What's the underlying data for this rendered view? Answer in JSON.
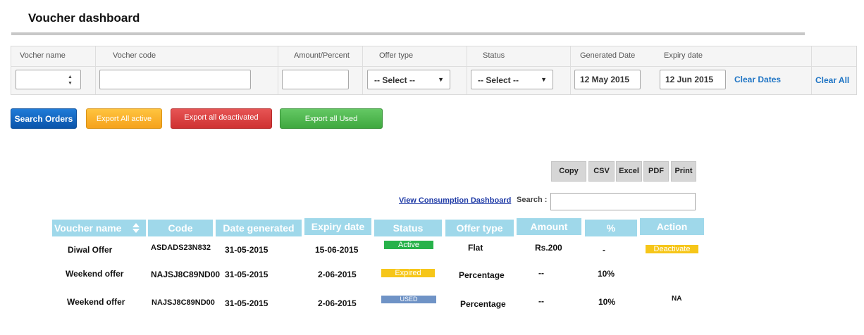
{
  "page": {
    "title": "Voucher dashboard"
  },
  "filter": {
    "headers": {
      "voucher_name": "Vocher name",
      "voucher_code": "Vocher code",
      "amount_percent": "Amount/Percent",
      "offer_type": "Offer type",
      "status": "Status",
      "generated_date": "Generated Date",
      "expiry_date": "Expiry date"
    },
    "offer_type_selected": "-- Select --",
    "status_selected": "-- Select --",
    "generated_date_value": "12 May 2015",
    "expiry_date_value": "12 Jun 2015",
    "clear_dates": "Clear Dates",
    "clear_all": "Clear All"
  },
  "actions": {
    "search_orders": "Search Orders",
    "export_active": "Export All active",
    "export_deactivated": "Export all deactivated",
    "export_used": "Export all Used"
  },
  "toolbar": {
    "copy": "Copy",
    "csv": "CSV",
    "excel": "Excel",
    "pdf": "PDF",
    "print": "Print"
  },
  "table_controls": {
    "view_consumption": "View Consumption Dashboard",
    "search_label": "Search :"
  },
  "table": {
    "columns": [
      "Voucher name",
      "Code",
      "Date generated",
      "Expiry date",
      "Status",
      "Offer type",
      "Amount",
      "%",
      "Action"
    ],
    "rows": [
      {
        "name": "Diwal Offer",
        "code": "ASDADS23N832",
        "date_generated": "31-05-2015",
        "expiry": "15-06-2015",
        "status": "Active",
        "offer_type": "Flat",
        "amount": "Rs.200",
        "percent": "-",
        "action": "Deactivate"
      },
      {
        "name": "Weekend offer",
        "code": "NAJSJ8C89ND00",
        "date_generated": "31-05-2015",
        "expiry": "2-06-2015",
        "status": "Expired",
        "offer_type": "Percentage",
        "amount": "--",
        "percent": "10%",
        "action": ""
      },
      {
        "name": "Weekend offer",
        "code": "NAJSJ8C89ND00",
        "date_generated": "31-05-2015",
        "expiry": "2-06-2015",
        "status": "USED",
        "offer_type": "Percentage",
        "amount": "--",
        "percent": "10%",
        "action": "NA"
      }
    ]
  },
  "colors": {
    "header_bg": "#9fd8ea",
    "active": "#27b24a",
    "expired": "#f6c619",
    "used": "#6f93c6",
    "deactivate": "#f6c619",
    "link": "#1e74c4"
  },
  "icons": {
    "sort": "sort-icon",
    "dropdown": "chevron-down-icon",
    "spinner": "spinner-icon"
  }
}
